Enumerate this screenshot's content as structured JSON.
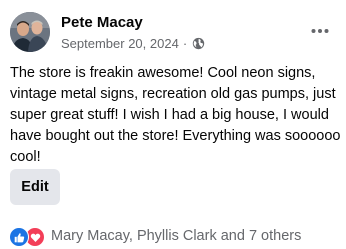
{
  "post": {
    "author": "Pete Macay",
    "date": "September 20, 2024",
    "separator": "·",
    "privacy_icon": "globe-icon",
    "more_icon": "more-options-icon",
    "text": "The store is freakin awesome! Cool neon signs, vintage metal signs, recreation old gas pumps, just super great stuff! I wish I had a big house, I would have bought out the store! Everything was soooooo cool!"
  },
  "actions": {
    "edit_label": "Edit"
  },
  "reactions": {
    "icons": [
      "like-icon",
      "love-icon"
    ],
    "summary": "Mary Macay, Phyllis Clark and 7 others"
  },
  "colors": {
    "like_blue": "#1b74e4",
    "love_red": "#f33e58",
    "secondary_text": "#65676b",
    "button_bg": "#e4e6eb"
  }
}
